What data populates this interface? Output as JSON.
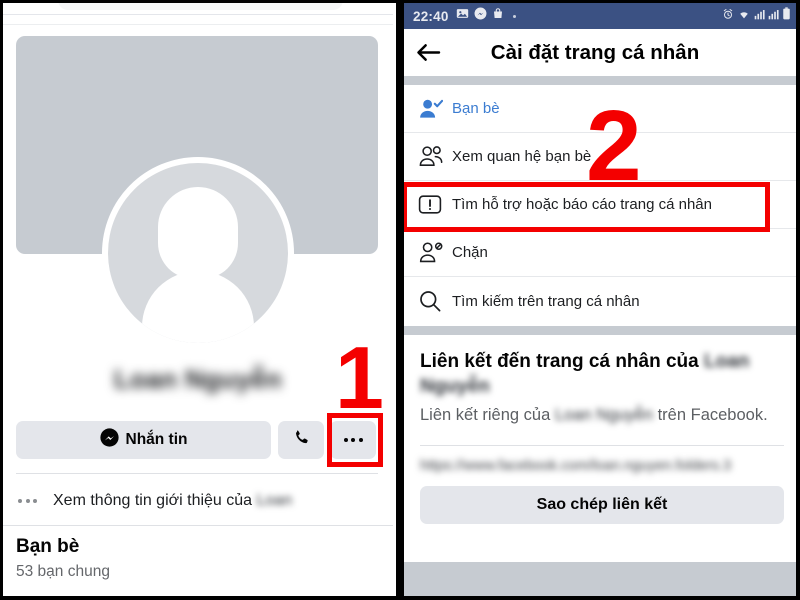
{
  "left_panel": {
    "name": "facebook-profile-view",
    "profile_name_blurred": "Loan Nguyễn",
    "buttons": {
      "message_label": "Nhắn tin",
      "message_icon": "messenger-icon",
      "call_icon": "phone-icon",
      "more_icon": "three-dots-icon"
    },
    "intro_row": {
      "icon": "three-dots-icon",
      "text_prefix": "Xem thông tin giới thiệu của ",
      "blurred_name": "Loan"
    },
    "friends": {
      "title": "Bạn bè",
      "subtitle": "53 bạn chung"
    }
  },
  "right_panel": {
    "status_bar": {
      "time": "22:40",
      "left_icons": [
        "photo-icon",
        "messenger-icon",
        "bag-icon"
      ],
      "right_icons": [
        "alarm-icon",
        "wifi-icon",
        "signal-icon",
        "signal-icon",
        "battery-icon"
      ],
      "background_color": "#3b5183"
    },
    "header": {
      "back_icon": "back-arrow-icon",
      "title": "Cài đặt trang cá nhân"
    },
    "menu_items": [
      {
        "icon": "person-check-icon",
        "label": "Bạn bè",
        "accent": true
      },
      {
        "icon": "two-people-icon",
        "label": "Xem quan hệ bạn bè",
        "accent": false
      },
      {
        "icon": "exclamation-box-icon",
        "label": "Tìm hỗ trợ hoặc báo cáo trang cá nhân",
        "accent": false
      },
      {
        "icon": "person-block-icon",
        "label": "Chặn",
        "accent": false
      },
      {
        "icon": "search-icon",
        "label": "Tìm kiếm trên trang cá nhân",
        "accent": false
      }
    ],
    "link_section": {
      "heading_prefix": "Liên kết đến trang cá nhân của ",
      "heading_blurred_name": "Loan Nguyễn",
      "desc_prefix": "Liên kết riêng của ",
      "desc_blurred_name": "Loan Nguyễn",
      "desc_suffix": " trên Facebook.",
      "url_blurred": "https://www.facebook.com/loan.nguyen.folders.3",
      "copy_button_label": "Sao chép liên kết"
    }
  },
  "annotations": {
    "step_1": "1",
    "step_2": "2",
    "color": "#f40000"
  }
}
